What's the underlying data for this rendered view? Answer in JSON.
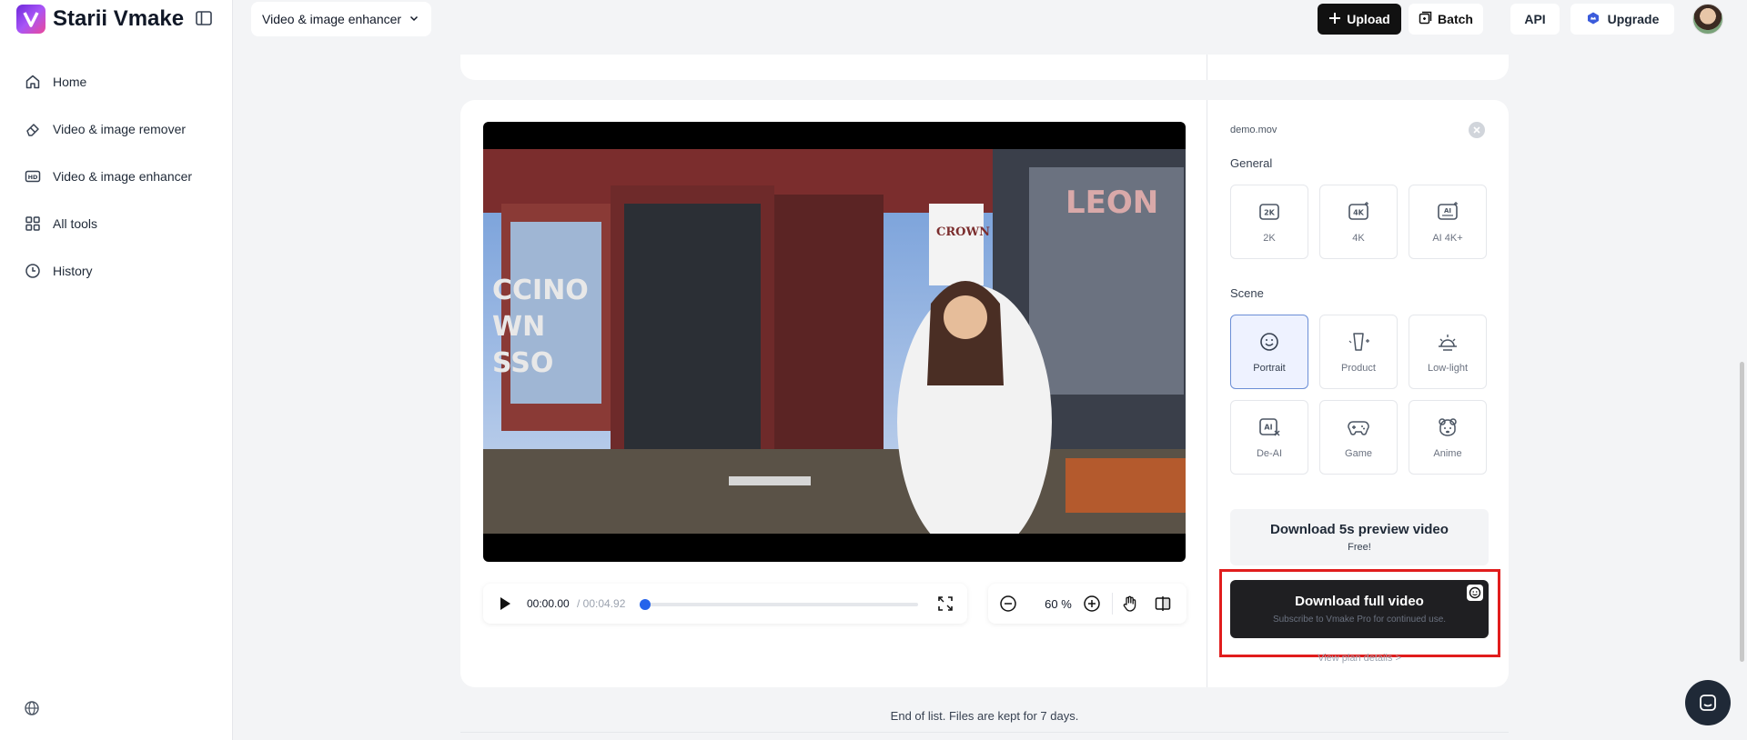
{
  "app": {
    "name": "Starii Vmake"
  },
  "sidebar": {
    "items": [
      {
        "label": "Home",
        "icon": "home-icon"
      },
      {
        "label": "Video & image remover",
        "icon": "eraser-icon"
      },
      {
        "label": "Video & image enhancer",
        "icon": "hd-icon"
      },
      {
        "label": "All tools",
        "icon": "grid-icon"
      },
      {
        "label": "History",
        "icon": "clock-icon"
      }
    ]
  },
  "header": {
    "tool_select": "Video & image enhancer",
    "upload": "Upload",
    "batch": "Batch",
    "api": "API",
    "upgrade": "Upgrade"
  },
  "player": {
    "current_time": "00:00.00",
    "total_time": "/ 00:04.92",
    "progress": 0.02,
    "zoom": "60 %"
  },
  "panel": {
    "filename": "demo.mov",
    "general_label": "General",
    "general_options": [
      "2K",
      "4K",
      "AI 4K+"
    ],
    "scene_label": "Scene",
    "scene_options": [
      "Portrait",
      "Product",
      "Low-light",
      "De-AI",
      "Game",
      "Anime"
    ],
    "selected_scene": "Portrait",
    "download_preview": {
      "title": "Download 5s preview video",
      "subtitle": "Free!"
    },
    "download_full": {
      "title": "Download full video",
      "subtitle": "Subscribe to Vmake Pro for continued use."
    },
    "plan_link": "View plan details >"
  },
  "footer": {
    "end_note": "End of list. Files are kept for 7 days."
  },
  "colors": {
    "accent": "#2563eb",
    "highlight": "#e11d1d",
    "brand_start": "#6d28d9",
    "brand_end": "#ec4899"
  }
}
